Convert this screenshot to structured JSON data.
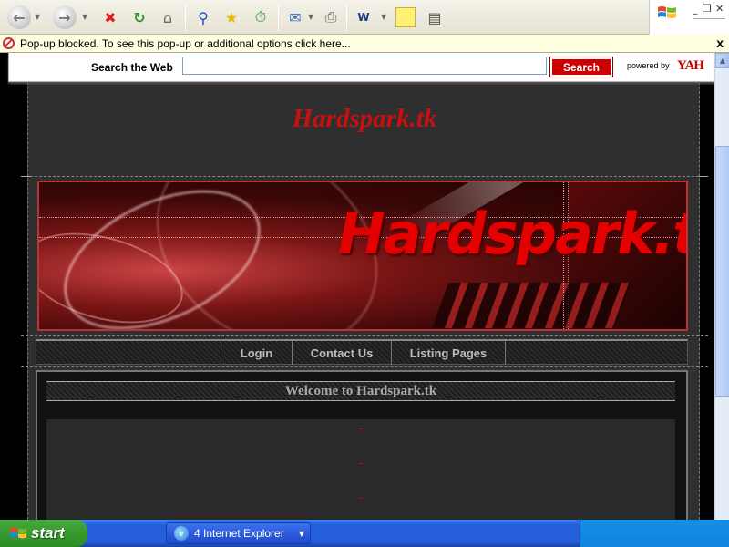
{
  "toolbar": {
    "buttons": [
      "back-icon",
      "forward-icon",
      "stop-icon",
      "refresh-icon",
      "home-icon",
      "search-icon",
      "favorites-icon",
      "history-icon",
      "mail-icon",
      "print-icon",
      "word-icon",
      "notes-icon",
      "research-icon"
    ]
  },
  "window": {
    "minimize": "_",
    "restore": "❐",
    "close": "✕"
  },
  "infobar": {
    "text": "Pop-up blocked. To see this pop-up or additional options click here...",
    "close": "x"
  },
  "searchbar": {
    "label": "Search the Web",
    "query_value": "",
    "button_label": "Search",
    "powered_by": "powered by",
    "brand": "YAH"
  },
  "site": {
    "title": "Hardspark.tk",
    "banner_text": "Hardspark.tk",
    "nav": [
      "Login",
      "Contact Us",
      "Listing Pages"
    ],
    "welcome": "Welcome to Hardspark.tk",
    "content_markers": [
      "-",
      "-",
      "-"
    ]
  },
  "taskbar": {
    "start_label": "start",
    "task_label": "4 Internet Explorer"
  },
  "colors": {
    "accent_red": "#c81010",
    "page_bg": "#2f2f2f",
    "taskbar_blue": "#245edb",
    "start_green": "#379b2e"
  }
}
